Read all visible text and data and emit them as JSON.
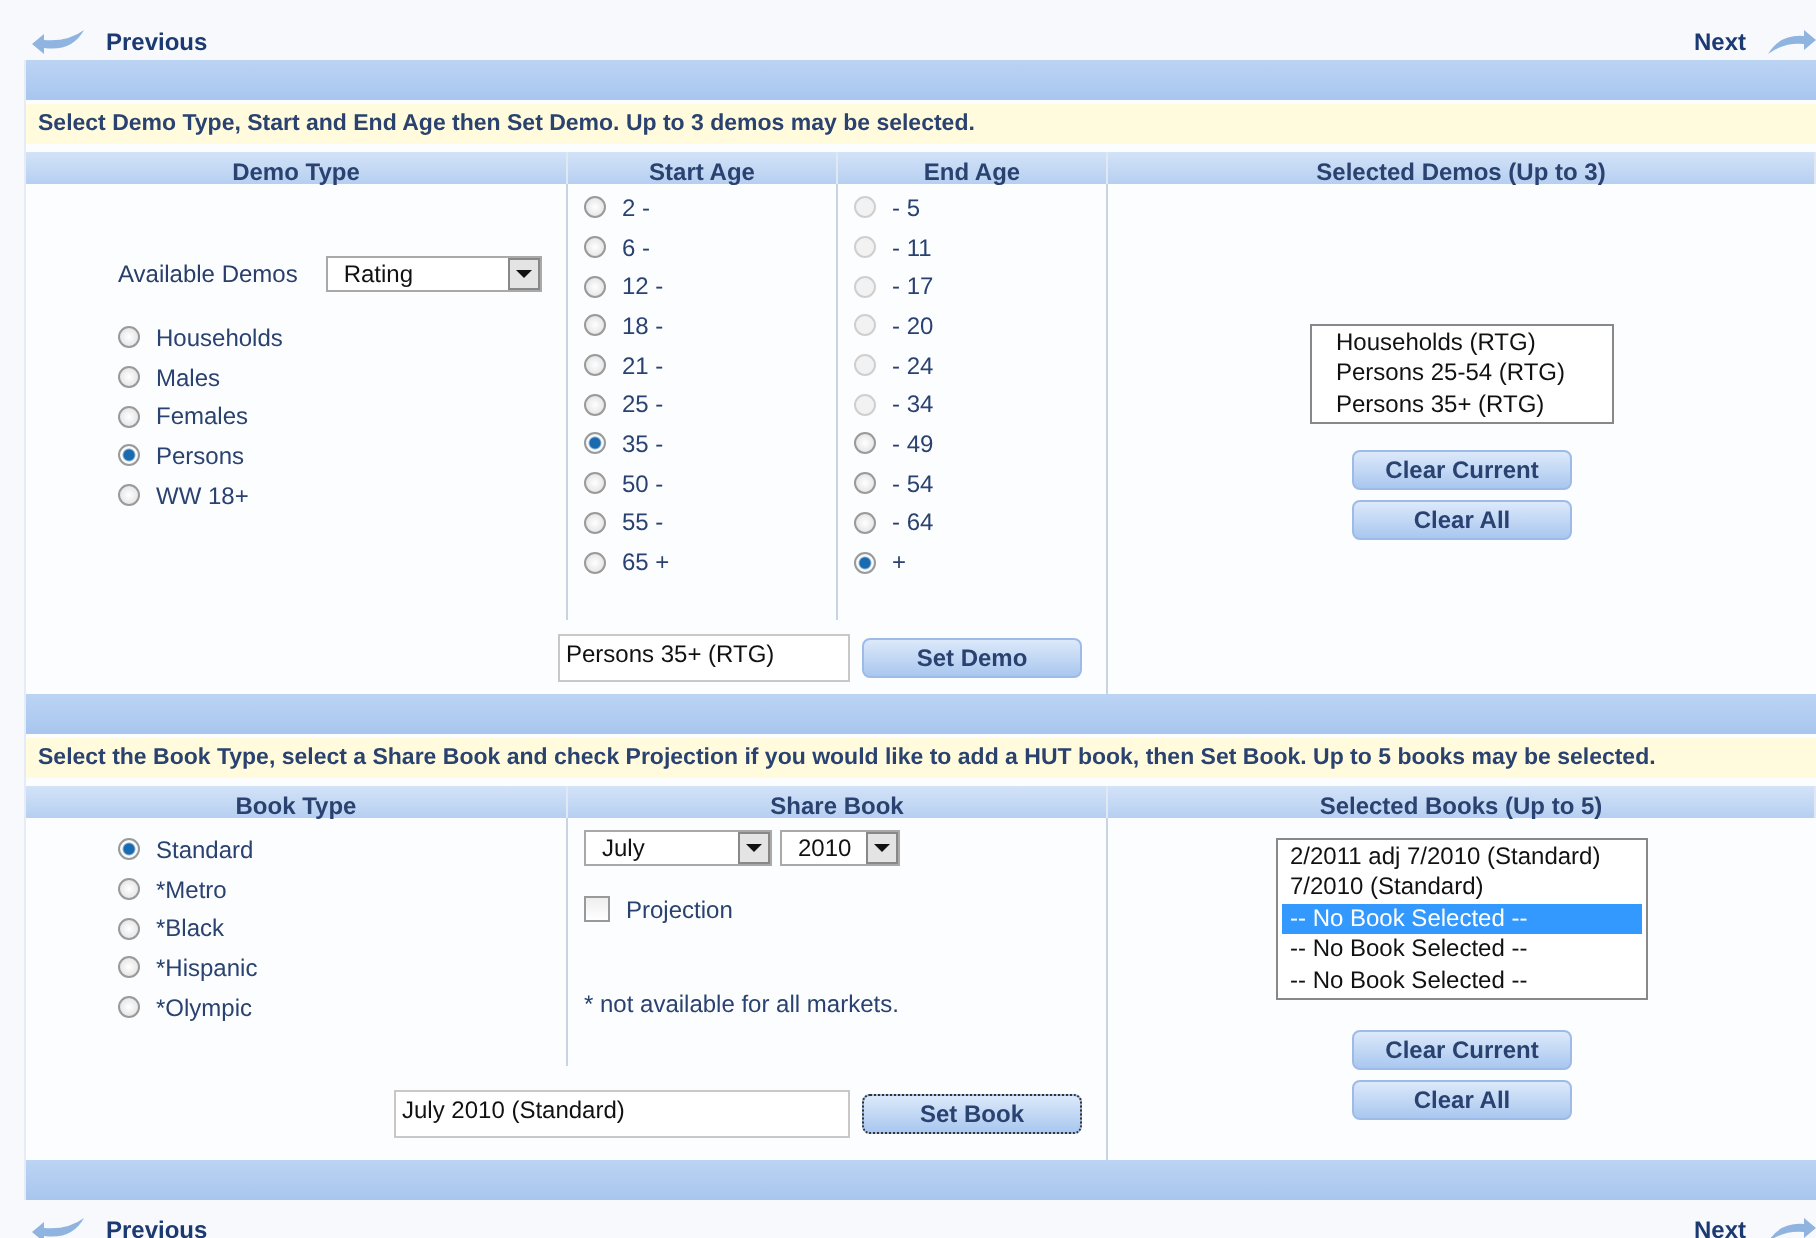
{
  "nav_top": {
    "previous": "Previous",
    "next": "Next"
  },
  "demo_section": {
    "instruction": "Select Demo Type, Start and End Age then Set Demo. Up to 3 demos may be selected.",
    "headers": [
      "Demo Type",
      "Start Age",
      "End Age",
      "Selected Demos (Up to 3)"
    ],
    "available_label": "Available Demos",
    "available_value": "Rating",
    "demo_types": [
      {
        "label": "Households",
        "selected": false
      },
      {
        "label": "Males",
        "selected": false
      },
      {
        "label": "Females",
        "selected": false
      },
      {
        "label": "Persons",
        "selected": true
      },
      {
        "label": "WW 18+",
        "selected": false
      }
    ],
    "start_ages": [
      {
        "label": "2 -",
        "selected": false
      },
      {
        "label": "6 -",
        "selected": false
      },
      {
        "label": "12 -",
        "selected": false
      },
      {
        "label": "18 -",
        "selected": false
      },
      {
        "label": "21 -",
        "selected": false
      },
      {
        "label": "25 -",
        "selected": false
      },
      {
        "label": "35 -",
        "selected": true
      },
      {
        "label": "50 -",
        "selected": false
      },
      {
        "label": "55 -",
        "selected": false
      },
      {
        "label": "65 +",
        "selected": false
      }
    ],
    "end_ages": [
      {
        "label": "- 5",
        "selected": false,
        "disabled": true
      },
      {
        "label": "- 11",
        "selected": false,
        "disabled": true
      },
      {
        "label": "- 17",
        "selected": false,
        "disabled": true
      },
      {
        "label": "- 20",
        "selected": false,
        "disabled": true
      },
      {
        "label": "- 24",
        "selected": false,
        "disabled": true
      },
      {
        "label": "- 34",
        "selected": false,
        "disabled": true
      },
      {
        "label": "- 49",
        "selected": false,
        "disabled": false
      },
      {
        "label": "- 54",
        "selected": false,
        "disabled": false
      },
      {
        "label": "- 64",
        "selected": false,
        "disabled": false
      },
      {
        "label": "+",
        "selected": true,
        "disabled": false
      }
    ],
    "current_demo": "Persons 35+ (RTG)",
    "set_button": "Set Demo",
    "selected_list": [
      {
        "label": "Households (RTG)",
        "selected": false
      },
      {
        "label": "Persons 25-54 (RTG)",
        "selected": false
      },
      {
        "label": "Persons 35+ (RTG)",
        "selected": false
      }
    ],
    "buttons": [
      "Clear Current",
      "Clear All"
    ]
  },
  "book_section": {
    "instruction": "Select the Book Type, select a Share Book and check Projection if you would like to add a HUT book, then Set Book. Up to 5 books may be selected.",
    "headers": [
      "Book Type",
      "Share Book",
      "Selected Books (Up to 5)"
    ],
    "book_types": [
      {
        "label": "Standard",
        "selected": true
      },
      {
        "label": "*Metro",
        "selected": false
      },
      {
        "label": "*Black",
        "selected": false
      },
      {
        "label": "*Hispanic",
        "selected": false
      },
      {
        "label": "*Olympic",
        "selected": false
      }
    ],
    "month": "July",
    "year": "2010",
    "projection": {
      "label": "Projection",
      "checked": false
    },
    "note": "* not available for all markets.",
    "current_book": "July 2010 (Standard)",
    "set_button": "Set Book",
    "selected_list": [
      {
        "label": "2/2011 adj 7/2010 (Standard)",
        "selected": false
      },
      {
        "label": "7/2010 (Standard)",
        "selected": false
      },
      {
        "label": "-- No Book Selected --",
        "selected": true
      },
      {
        "label": "-- No Book Selected --",
        "selected": false
      },
      {
        "label": "-- No Book Selected --",
        "selected": false
      }
    ],
    "buttons": [
      "Clear Current",
      "Clear All"
    ]
  },
  "nav_bottom": {
    "previous": "Previous",
    "next": "Next"
  }
}
